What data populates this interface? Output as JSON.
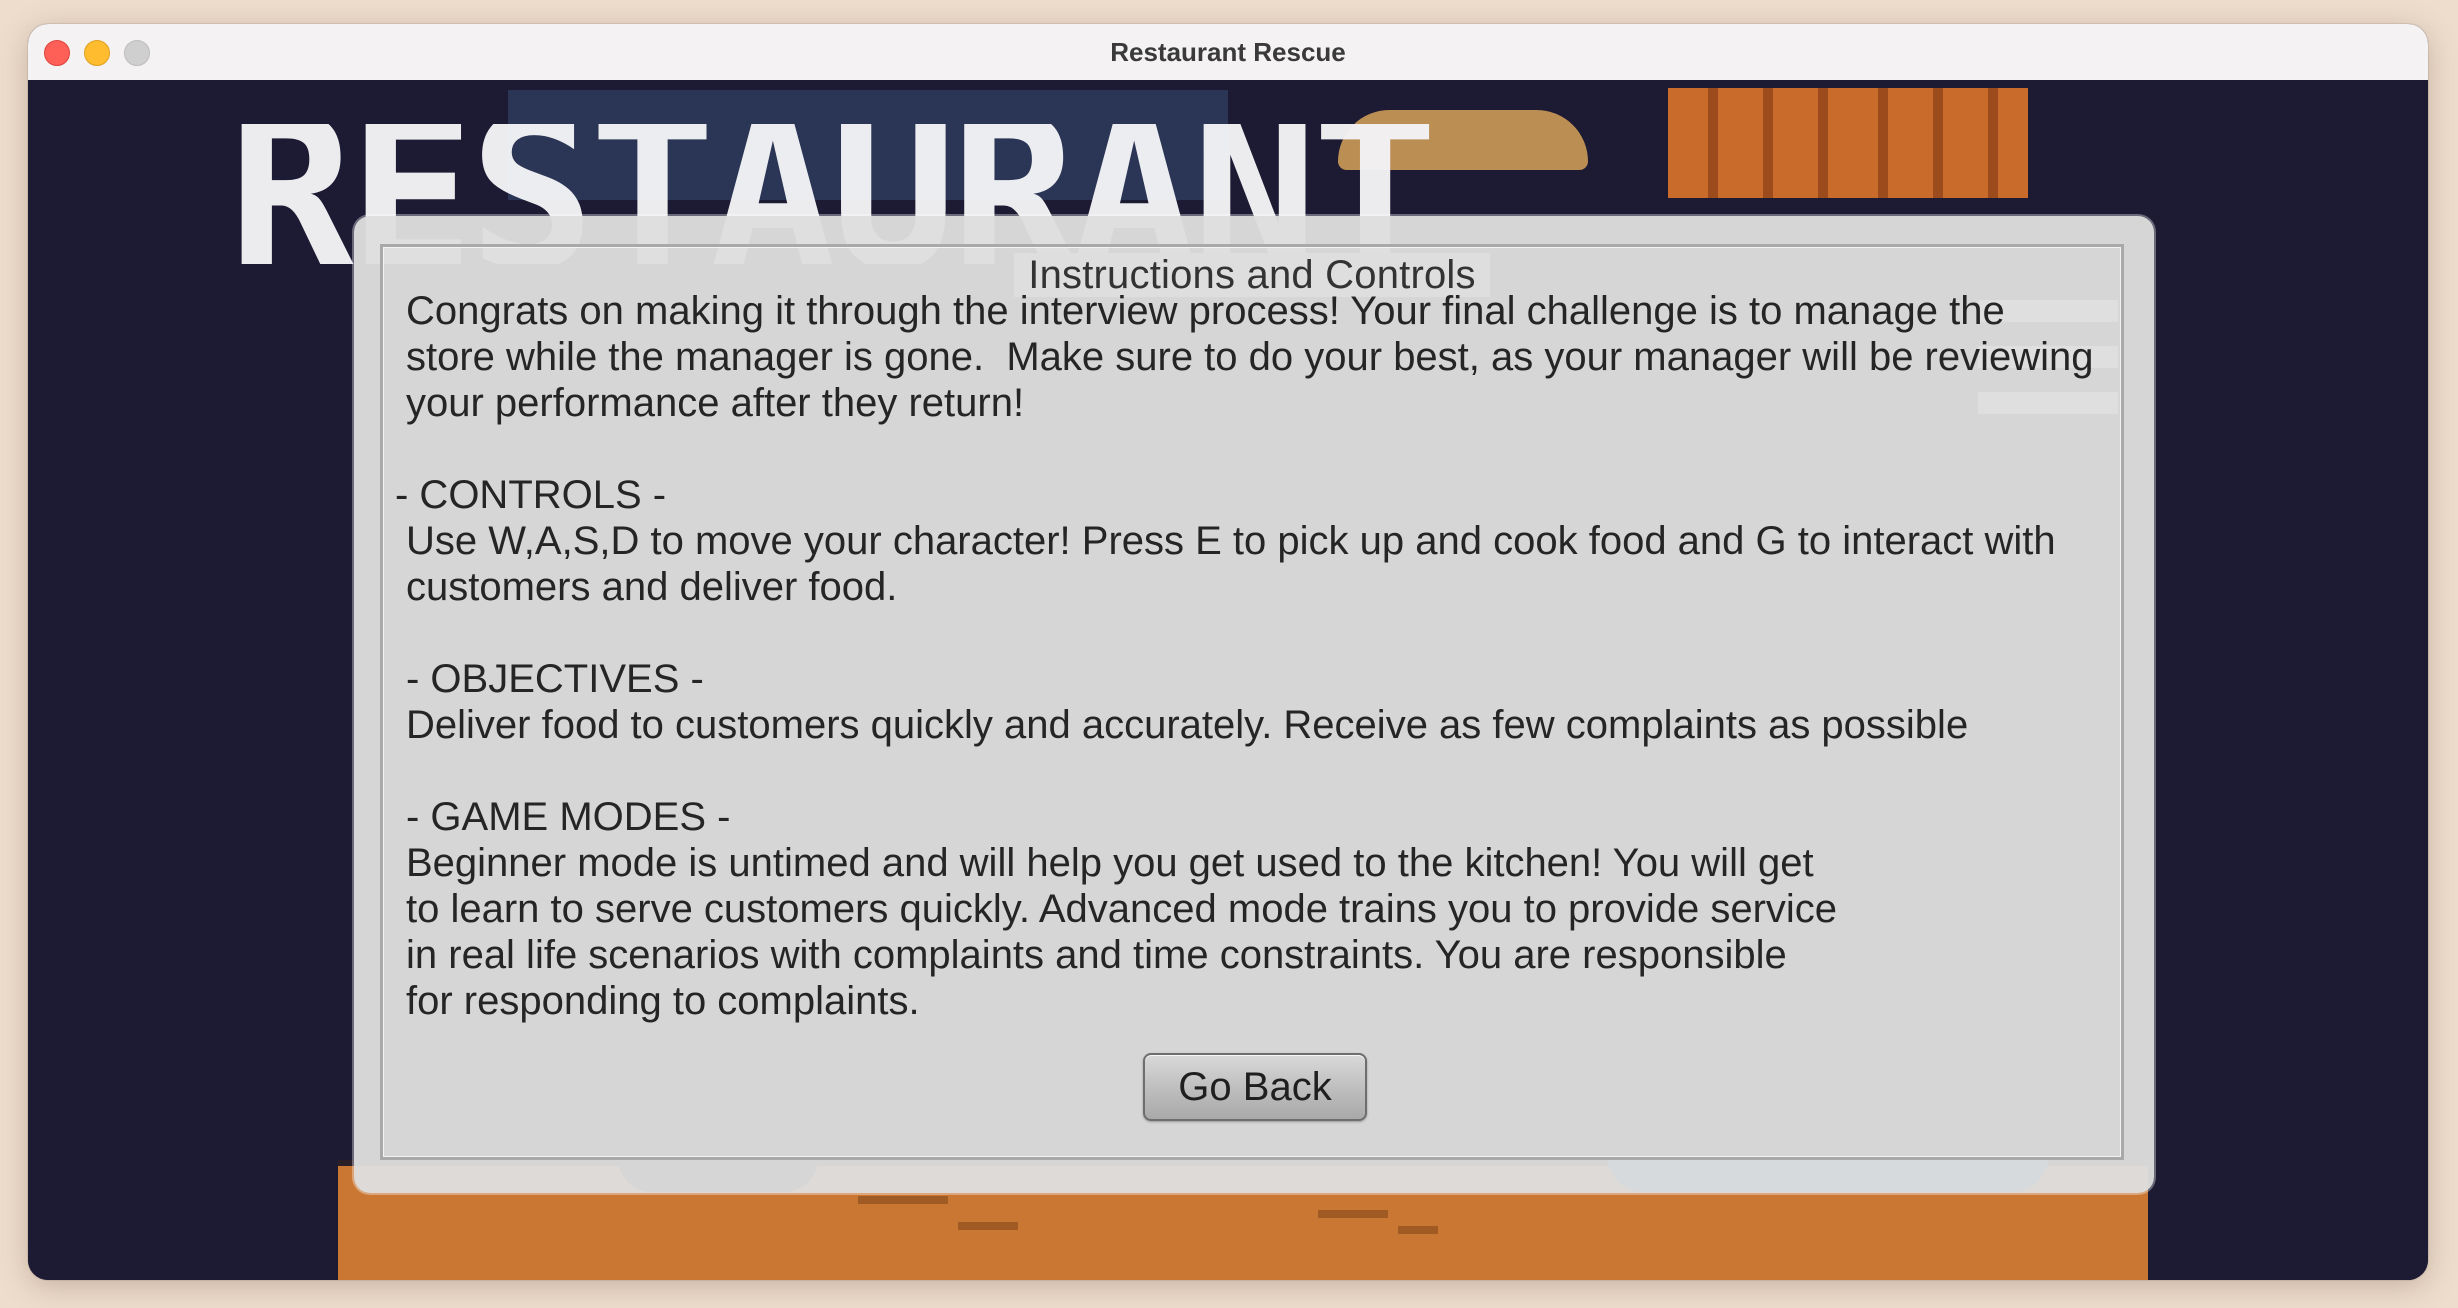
{
  "window": {
    "title": "Restaurant Rescue"
  },
  "background": {
    "title_art": "RESTAURANT"
  },
  "dialog": {
    "legend": "Instructions and Controls",
    "intro": "Congrats on making it through the interview process! Your final challenge is to manage the\nstore while the manager is gone.  Make sure to do your best, as your manager will be reviewing\nyour performance after they return!",
    "controls_heading": "- CONTROLS -",
    "controls_text": "Use W,A,S,D to move your character! Press E to pick up and cook food and G to interact with\ncustomers and deliver food.",
    "objectives_heading": "- OBJECTIVES -",
    "objectives_text": "Deliver food to customers quickly and accurately. Receive as few complaints as possible",
    "modes_heading": "- GAME MODES -",
    "modes_text": "Beginner mode is untimed and will help you get used to the kitchen! You will get\nto learn to serve customers quickly. Advanced mode trains you to provide service\nin real life scenarios with complaints and time constraints. You are responsible\nfor responding to complaints.",
    "back_button": "Go Back"
  },
  "colors": {
    "close": "#fe5f57",
    "minimize": "#febc2e",
    "zoom": "#cfcfcf",
    "backdrop": "#1d1b34",
    "dialog_bg": "#dedede"
  }
}
